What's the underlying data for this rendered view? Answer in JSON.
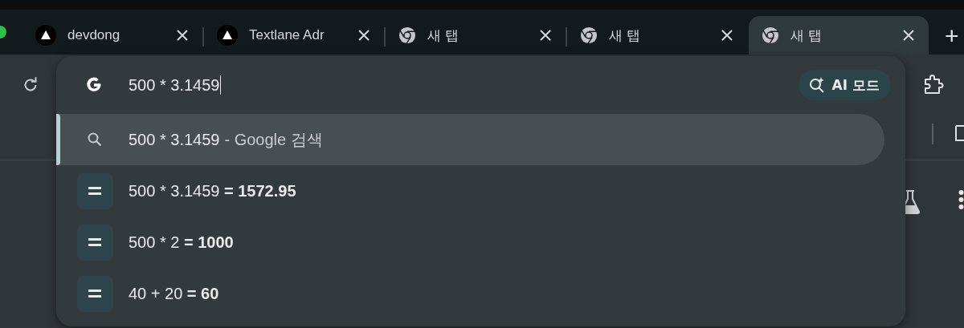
{
  "tabs": [
    {
      "title": "devdong",
      "kind": "site",
      "selected": false
    },
    {
      "title": "Textlane Adr",
      "kind": "site",
      "selected": false
    },
    {
      "title": "새 탭",
      "kind": "newtab",
      "selected": false
    },
    {
      "title": "새 탭",
      "kind": "newtab",
      "selected": false
    },
    {
      "title": "새 탭",
      "kind": "newtab",
      "selected": true
    }
  ],
  "new_tab_button": "+",
  "omnibox": {
    "value": "500 * 3.1459",
    "ai_button": "AI 모드",
    "suggestions": [
      {
        "kind": "search",
        "text": "500 * 3.1459",
        "source": "- Google 검색",
        "selected": true
      },
      {
        "kind": "calculator",
        "text": "500 * 3.1459 **= 1572.95**",
        "selected": false
      },
      {
        "kind": "calculator",
        "text": "500 * 2 **= 1000**",
        "selected": false
      },
      {
        "kind": "calculator",
        "text": "40 + 20 **= 60**",
        "selected": false
      }
    ]
  }
}
